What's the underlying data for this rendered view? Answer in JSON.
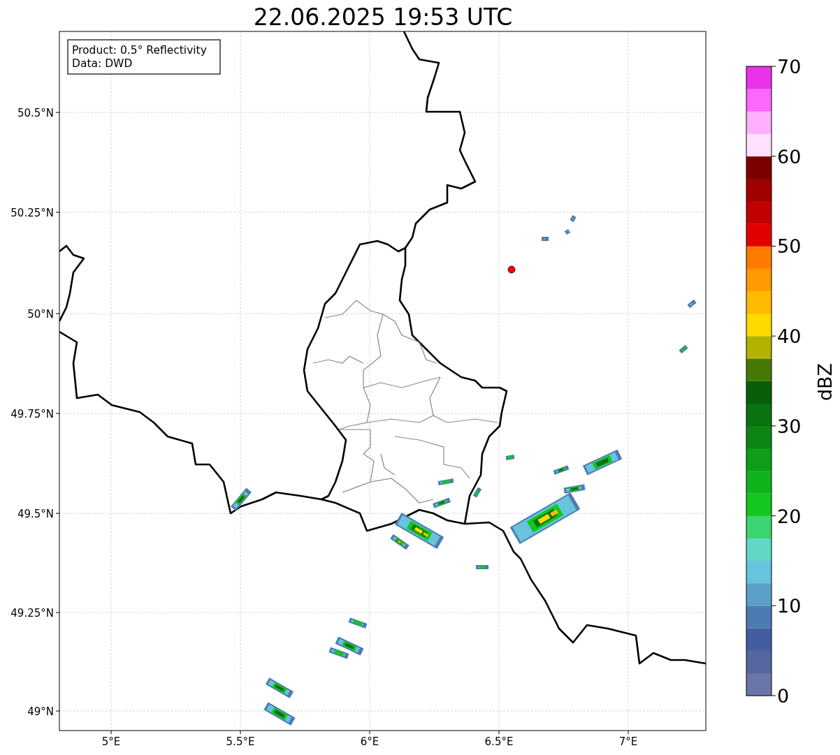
{
  "title": "22.06.2025 19:53 UTC",
  "legend": [
    "Product: 0.5° Reflectivity",
    "Data: DWD"
  ],
  "map": {
    "x_axis": [
      "5°E",
      "5.5°E",
      "6°E",
      "6.5°E",
      "7°E"
    ],
    "y_axis": [
      "50.5°N",
      "50.25°N",
      "50°N",
      "49.75°N",
      "49.5°N",
      "49.25°N",
      "49°N"
    ]
  },
  "colorbar": {
    "label": "dBZ",
    "ticks": [
      "70",
      "60",
      "50",
      "40",
      "30",
      "20",
      "10",
      "0"
    ],
    "bins": [
      {
        "color": "#6a76a8"
      },
      {
        "color": "#5667a0"
      },
      {
        "color": "#445da0"
      },
      {
        "color": "#4c7bb1"
      },
      {
        "color": "#5a9fc8"
      },
      {
        "color": "#67c3de"
      },
      {
        "color": "#60d8c5"
      },
      {
        "color": "#3cd470"
      },
      {
        "color": "#12c81e"
      },
      {
        "color": "#10b31c"
      },
      {
        "color": "#0e9e17"
      },
      {
        "color": "#0c8716"
      },
      {
        "color": "#0a7210"
      },
      {
        "color": "#085e0a"
      },
      {
        "color": "#467806"
      },
      {
        "color": "#b2b200"
      },
      {
        "color": "#ffd900"
      },
      {
        "color": "#ffba00"
      },
      {
        "color": "#ff9b00"
      },
      {
        "color": "#ff7b00"
      },
      {
        "color": "#e10000"
      },
      {
        "color": "#c10000"
      },
      {
        "color": "#a00000"
      },
      {
        "color": "#7a0000"
      },
      {
        "color": "#ffe0ff"
      },
      {
        "color": "#ffb0fd"
      },
      {
        "color": "#fb68fb"
      },
      {
        "color": "#e932ea"
      }
    ]
  }
}
